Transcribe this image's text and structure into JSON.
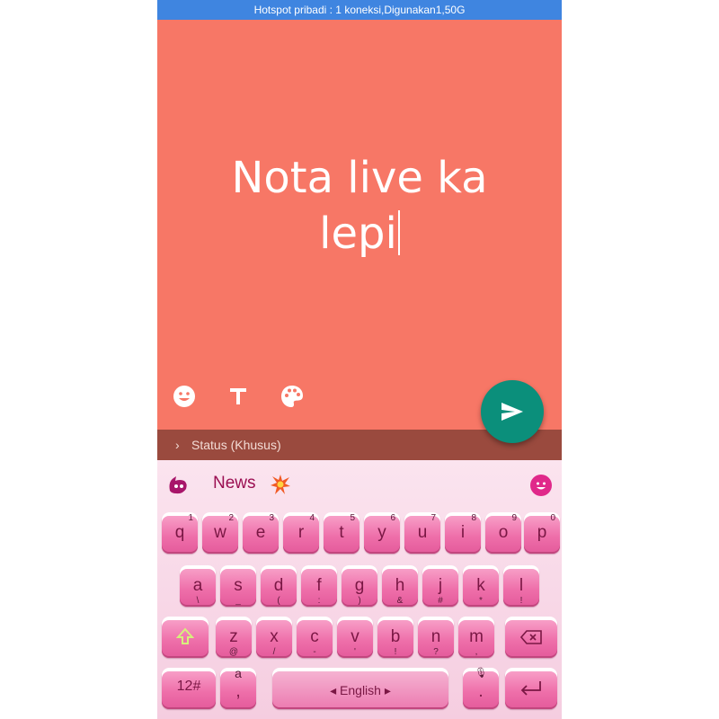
{
  "status_bar": {
    "text": "Hotspot pribadi : 1 koneksi,Digunakan1,50G"
  },
  "composer": {
    "line1": "Nota live ka",
    "line2": "lepi",
    "audience_label": "Status (Khusus)"
  },
  "toolbar": {
    "emoji_icon": "smiley-icon",
    "text_icon": "text-format-icon",
    "color_icon": "palette-icon",
    "send_icon": "send-icon"
  },
  "keyboard": {
    "news_label": "News",
    "row1": [
      {
        "main": "q",
        "sub": "1"
      },
      {
        "main": "w",
        "sub": "2"
      },
      {
        "main": "e",
        "sub": "3"
      },
      {
        "main": "r",
        "sub": "4"
      },
      {
        "main": "t",
        "sub": "5"
      },
      {
        "main": "y",
        "sub": "6"
      },
      {
        "main": "u",
        "sub": "7"
      },
      {
        "main": "i",
        "sub": "8"
      },
      {
        "main": "o",
        "sub": "9"
      },
      {
        "main": "p",
        "sub": "0"
      }
    ],
    "row2": [
      {
        "main": "a",
        "sub": "\\"
      },
      {
        "main": "s",
        "sub": "_"
      },
      {
        "main": "d",
        "sub": "("
      },
      {
        "main": "f",
        "sub": ":"
      },
      {
        "main": "g",
        "sub": ")"
      },
      {
        "main": "h",
        "sub": "&"
      },
      {
        "main": "j",
        "sub": "#"
      },
      {
        "main": "k",
        "sub": "*"
      },
      {
        "main": "l",
        "sub": "!"
      }
    ],
    "row3": [
      {
        "main": "z",
        "sub": "@"
      },
      {
        "main": "x",
        "sub": "/"
      },
      {
        "main": "c",
        "sub": "-"
      },
      {
        "main": "v",
        "sub": "'"
      },
      {
        "main": "b",
        "sub": "!"
      },
      {
        "main": "n",
        "sub": "?"
      },
      {
        "main": "m",
        "sub": ","
      }
    ],
    "symbols_label": "12#",
    "comma_label": ",",
    "comma_top": "a",
    "space_label": "English",
    "space_left": "◂",
    "space_right": "▸",
    "period_label": ".",
    "mic_hint": "🎙"
  },
  "colors": {
    "compose_bg": "#f77766",
    "fab": "#0b8f7b",
    "statusbar": "#3f85e0",
    "key_text": "#7a1744"
  }
}
